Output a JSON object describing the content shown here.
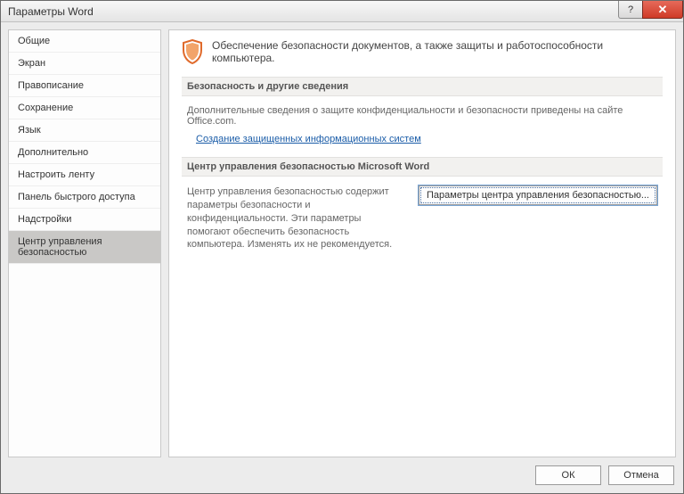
{
  "window": {
    "title": "Параметры Word"
  },
  "sidebar": {
    "items": [
      {
        "label": "Общие"
      },
      {
        "label": "Экран"
      },
      {
        "label": "Правописание"
      },
      {
        "label": "Сохранение"
      },
      {
        "label": "Язык"
      },
      {
        "label": "Дополнительно"
      },
      {
        "label": "Настроить ленту"
      },
      {
        "label": "Панель быстрого доступа"
      },
      {
        "label": "Надстройки"
      },
      {
        "label": "Центр управления безопасностью"
      }
    ],
    "selected_index": 9
  },
  "hero": {
    "text": "Обеспечение безопасности документов, а также защиты и работоспособности компьютера."
  },
  "section_security": {
    "heading": "Безопасность и другие сведения",
    "body": "Дополнительные сведения о защите конфиденциальности и безопасности приведены на сайте Office.com.",
    "link": "Создание защищенных информационных систем"
  },
  "section_trust": {
    "heading": "Центр управления безопасностью Microsoft Word",
    "body": "Центр управления безопасностью содержит параметры безопасности и конфиденциальности. Эти параметры помогают обеспечить безопасность компьютера. Изменять их не рекомендуется.",
    "button": "Параметры центра управления безопасностью..."
  },
  "footer": {
    "ok": "ОК",
    "cancel": "Отмена"
  }
}
